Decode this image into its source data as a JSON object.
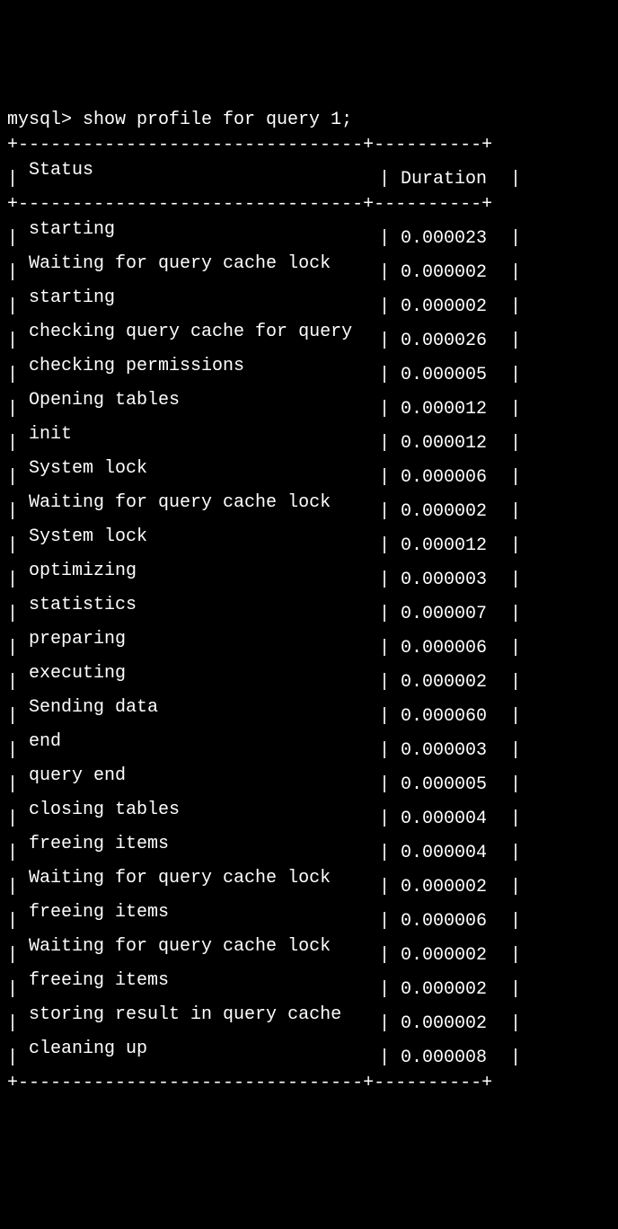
{
  "prompt": "mysql> ",
  "command": "show profile for query 1;",
  "header": {
    "status": "Status",
    "duration": "Duration"
  },
  "border_top": "+--------------------------------+----------+",
  "border_header": "+--------------------------------+----------+",
  "border_bottom": "+--------------------------------+----------+",
  "rows": [
    {
      "status": "starting",
      "duration": "0.000023"
    },
    {
      "status": "Waiting for query cache lock",
      "duration": "0.000002"
    },
    {
      "status": "starting",
      "duration": "0.000002"
    },
    {
      "status": "checking query cache for query",
      "duration": "0.000026"
    },
    {
      "status": "checking permissions",
      "duration": "0.000005"
    },
    {
      "status": "Opening tables",
      "duration": "0.000012"
    },
    {
      "status": "init",
      "duration": "0.000012"
    },
    {
      "status": "System lock",
      "duration": "0.000006"
    },
    {
      "status": "Waiting for query cache lock",
      "duration": "0.000002"
    },
    {
      "status": "System lock",
      "duration": "0.000012"
    },
    {
      "status": "optimizing",
      "duration": "0.000003"
    },
    {
      "status": "statistics",
      "duration": "0.000007"
    },
    {
      "status": "preparing",
      "duration": "0.000006"
    },
    {
      "status": "executing",
      "duration": "0.000002"
    },
    {
      "status": "Sending data",
      "duration": "0.000060"
    },
    {
      "status": "end",
      "duration": "0.000003"
    },
    {
      "status": "query end",
      "duration": "0.000005"
    },
    {
      "status": "closing tables",
      "duration": "0.000004"
    },
    {
      "status": "freeing items",
      "duration": "0.000004"
    },
    {
      "status": "Waiting for query cache lock",
      "duration": "0.000002"
    },
    {
      "status": "freeing items",
      "duration": "0.000006"
    },
    {
      "status": "Waiting for query cache lock",
      "duration": "0.000002"
    },
    {
      "status": "freeing items",
      "duration": "0.000002"
    },
    {
      "status": "storing result in query cache",
      "duration": "0.000002"
    },
    {
      "status": "cleaning up",
      "duration": "0.000008"
    }
  ]
}
